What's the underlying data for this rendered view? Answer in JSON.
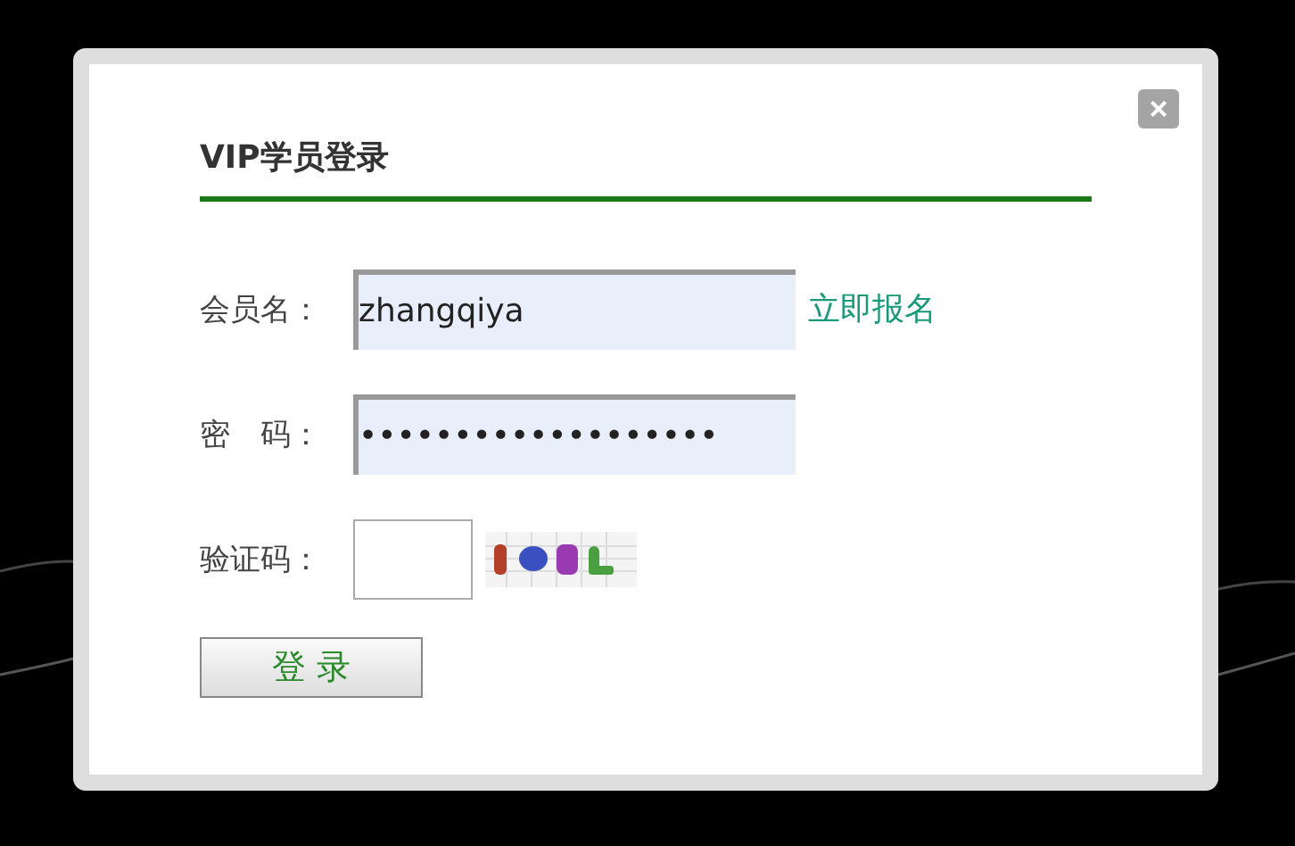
{
  "dialog": {
    "title": "VIP学员登录",
    "close": "×"
  },
  "fields": [
    {
      "label": "会员名：",
      "value": "zhangqiya",
      "link": "立即报名",
      "kind": "text"
    },
    {
      "label": "密　码：",
      "value": "•••••••••••••••••••",
      "kind": "text"
    },
    {
      "label": "验证码：",
      "kind": "captcha"
    }
  ],
  "submit": "登 录"
}
